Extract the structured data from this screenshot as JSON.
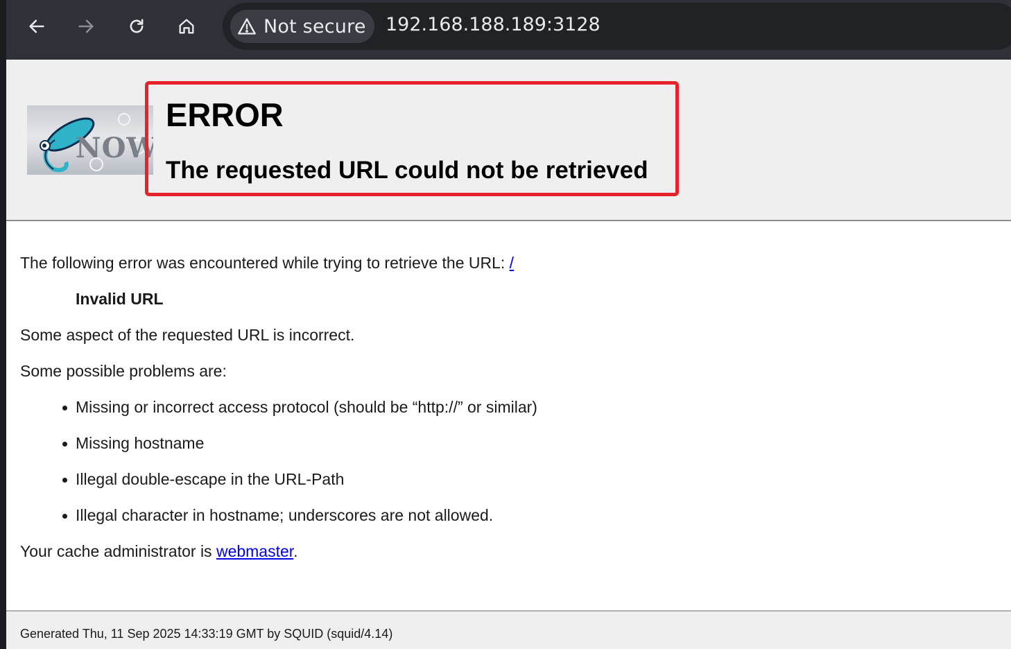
{
  "browser": {
    "security_label": "Not secure",
    "url": "192.168.188.189:3128"
  },
  "page": {
    "title": "ERROR",
    "subtitle": "The requested URL could not be retrieved",
    "intro": "The following error was encountered while trying to retrieve the URL: ",
    "intro_link": "/",
    "error_name": "Invalid URL",
    "description": "Some aspect of the requested URL is incorrect.",
    "problems_heading": "Some possible problems are:",
    "problems": [
      "Missing or incorrect access protocol (should be “http://” or similar)",
      "Missing hostname",
      "Illegal double-escape in the URL-Path",
      "Illegal character in hostname; underscores are not allowed."
    ],
    "admin_prefix": "Your cache administrator is ",
    "admin_link": "webmaster",
    "admin_suffix": ".",
    "footer": "Generated Thu, 11 Sep 2025 14:33:19 GMT by SQUID (squid/4.14)"
  },
  "logo": {
    "text": "NOW"
  },
  "colors": {
    "highlight": "#e8222b",
    "link": "#0000ee",
    "header_bg": "#efefef"
  }
}
